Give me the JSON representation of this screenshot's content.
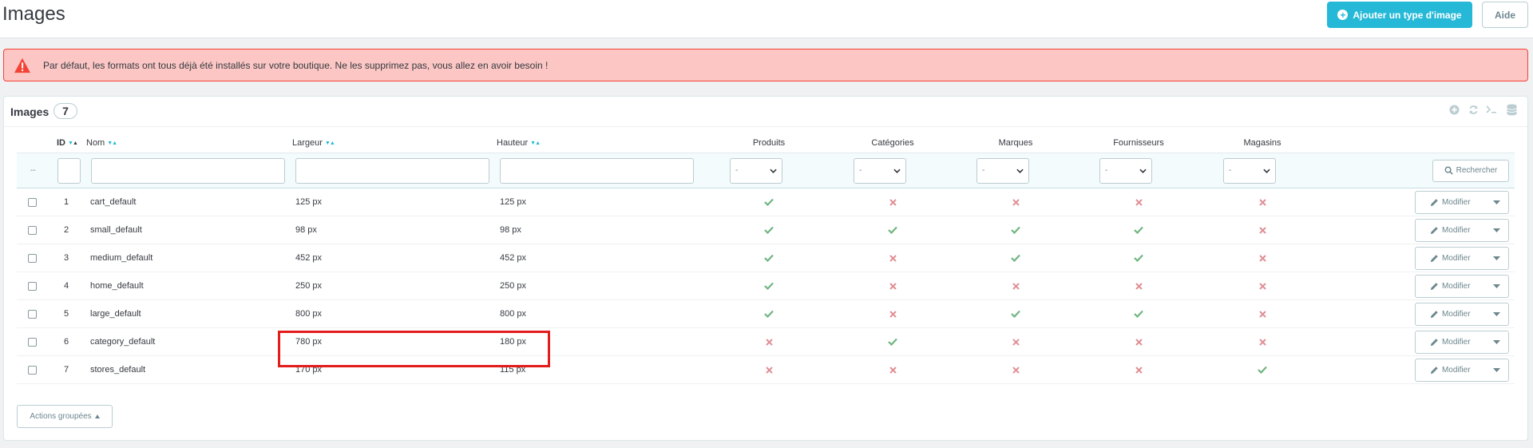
{
  "header": {
    "title": "Images",
    "add_button_label": "Ajouter un type d'image",
    "help_button_label": "Aide"
  },
  "alert": {
    "text": "Par défaut, les formats ont tous déjà été installés sur votre boutique. Ne les supprimez pas, vous allez en avoir besoin !"
  },
  "panel": {
    "title": "Images",
    "count": "7"
  },
  "table": {
    "columns": {
      "id": "ID",
      "name": "Nom",
      "width": "Largeur",
      "height": "Hauteur",
      "products": "Produits",
      "categories": "Catégories",
      "brands": "Marques",
      "suppliers": "Fournisseurs",
      "stores": "Magasins"
    },
    "filter": {
      "reset_symbol": "--",
      "select_value": "-",
      "search_label": "Rechercher"
    },
    "rows": [
      {
        "id": "1",
        "name": "cart_default",
        "width": "125 px",
        "height": "125 px",
        "products": true,
        "categories": false,
        "brands": false,
        "suppliers": false,
        "stores": false
      },
      {
        "id": "2",
        "name": "small_default",
        "width": "98 px",
        "height": "98 px",
        "products": true,
        "categories": true,
        "brands": true,
        "suppliers": true,
        "stores": false
      },
      {
        "id": "3",
        "name": "medium_default",
        "width": "452 px",
        "height": "452 px",
        "products": true,
        "categories": false,
        "brands": true,
        "suppliers": true,
        "stores": false
      },
      {
        "id": "4",
        "name": "home_default",
        "width": "250 px",
        "height": "250 px",
        "products": true,
        "categories": false,
        "brands": false,
        "suppliers": false,
        "stores": false
      },
      {
        "id": "5",
        "name": "large_default",
        "width": "800 px",
        "height": "800 px",
        "products": true,
        "categories": false,
        "brands": true,
        "suppliers": true,
        "stores": false
      },
      {
        "id": "6",
        "name": "category_default",
        "width": "780 px",
        "height": "180 px",
        "products": false,
        "categories": true,
        "brands": false,
        "suppliers": false,
        "stores": false
      },
      {
        "id": "7",
        "name": "stores_default",
        "width": "170 px",
        "height": "115 px",
        "products": false,
        "categories": false,
        "brands": false,
        "suppliers": false,
        "stores": true
      }
    ],
    "row_action_label": "Modifier"
  },
  "bulk_actions_label": "Actions groupées",
  "colors": {
    "primary": "#25b9d7",
    "success": "#70b580",
    "danger": "#e08f95",
    "alert_bg": "#fbc6c3",
    "alert_border": "#f44336",
    "highlight": "#e31c1c"
  },
  "icons": {
    "alert": "warning-triangle-icon",
    "add": "plus-circle-icon",
    "yes": "check-icon",
    "no": "cross-icon",
    "edit": "pencil-icon",
    "search": "search-icon",
    "dropdown": "caret-down-icon"
  }
}
